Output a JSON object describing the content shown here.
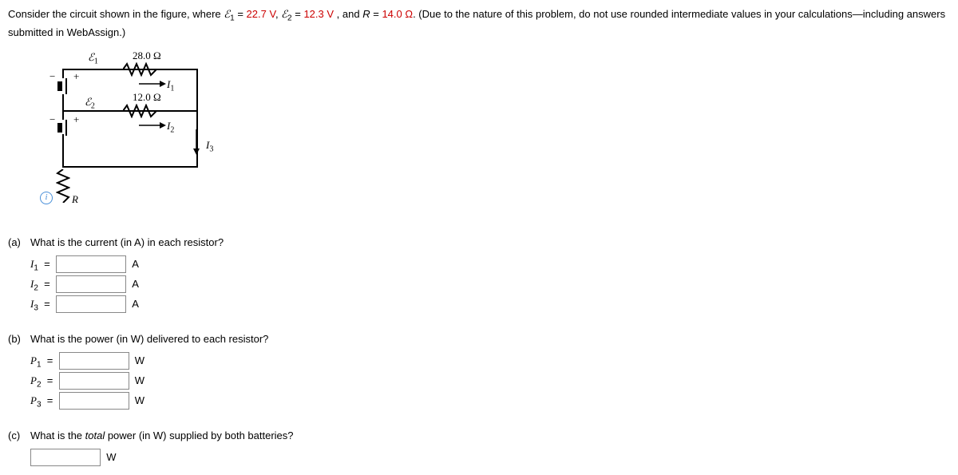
{
  "problem": {
    "intro_a": "Consider the circuit shown in the figure, where ",
    "e1_sym": "ℰ",
    "e1_sub": "1",
    "eq": " = ",
    "e1_val": "22.7 V",
    "comma1": ", ",
    "e2_sym": "ℰ",
    "e2_sub": "2",
    "e2_val": "12.3 V",
    "and": ", and ",
    "R_sym": "R",
    "R_val": "14.0 Ω",
    "tail": ". (Due to the nature of this problem, do not use rounded intermediate values in your calculations—including answers submitted in WebAssign.)"
  },
  "figure": {
    "e1": "ℰ",
    "e1_sub": "1",
    "e2": "ℰ",
    "e2_sub": "2",
    "r1": "28.0 Ω",
    "r2": "12.0 Ω",
    "I1": "I",
    "I1_sub": "1",
    "I2": "I",
    "I2_sub": "2",
    "I3": "I",
    "I3_sub": "3",
    "R": "R",
    "minus": "−",
    "plus": "+",
    "info": "i"
  },
  "parts": {
    "a": {
      "label": "(a)",
      "q": "What is the current (in A) in each resistor?",
      "rows": [
        {
          "sym": "I",
          "sub": "1",
          "unit": "A"
        },
        {
          "sym": "I",
          "sub": "2",
          "unit": "A"
        },
        {
          "sym": "I",
          "sub": "3",
          "unit": "A"
        }
      ]
    },
    "b": {
      "label": "(b)",
      "q": "What is the power (in W) delivered to each resistor?",
      "rows": [
        {
          "sym": "P",
          "sub": "1",
          "unit": "W"
        },
        {
          "sym": "P",
          "sub": "2",
          "unit": "W"
        },
        {
          "sym": "P",
          "sub": "3",
          "unit": "W"
        }
      ]
    },
    "c": {
      "label": "(c)",
      "q_a": "What is the ",
      "q_b": "total",
      "q_c": " power (in W) supplied by both batteries?",
      "unit": "W"
    }
  }
}
